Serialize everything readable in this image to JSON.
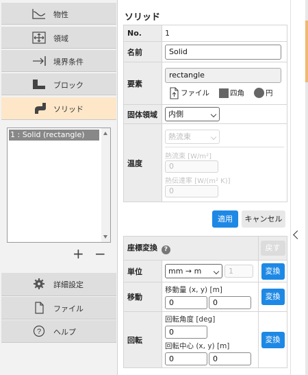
{
  "sidebar": {
    "items": [
      {
        "label": "物性",
        "icon": "curve-icon"
      },
      {
        "label": "領域",
        "icon": "move-arrows-icon"
      },
      {
        "label": "境界条件",
        "icon": "arrow-to-wall-icon"
      },
      {
        "label": "ブロック",
        "icon": "block-icon"
      },
      {
        "label": "ソリッド",
        "icon": "solid-pipe-icon"
      }
    ],
    "solid_list": [
      "1 : Solid (rectangle)"
    ],
    "add_label": "+",
    "remove_label": "−",
    "bottom_items": [
      {
        "label": "詳細設定",
        "icon": "gear-icon"
      },
      {
        "label": "ファイル",
        "icon": "file-icon"
      },
      {
        "label": "ヘルプ",
        "icon": "help-icon"
      }
    ],
    "active_item": "ソリッド"
  },
  "panel": {
    "title": "ソリッド",
    "no_label": "No.",
    "no_value": "1",
    "name_label": "名前",
    "name_value": "Solid",
    "element_label": "要素",
    "element_value": "rectangle",
    "shape_file": "ファイル",
    "shape_rect": "四角",
    "shape_circle": "円",
    "solid_region_label": "固体領域",
    "solid_region_value": "内側",
    "temperature_label": "温度",
    "heat_mode_value": "熱流束",
    "heat_flux_label": "熱流束 [W/m²]",
    "heat_flux_value": "0",
    "htc_label": "熱伝達率 [W/(m² K)]",
    "htc_value": "0",
    "apply_label": "適用",
    "cancel_label": "キャンセル"
  },
  "transform": {
    "title": "座標変換",
    "help": "?",
    "reset_label": "戻す",
    "unit_label": "単位",
    "unit_value": "mm → m",
    "unit_factor": "1",
    "convert_label": "変換",
    "move_label": "移動",
    "move_amount_label": "移動量 (x, y) [m]",
    "move_x": "0",
    "move_y": "0",
    "rotate_label": "回転",
    "rotate_angle_label": "回転角度 [deg]",
    "rotate_angle": "0",
    "rotate_center_label": "回転中心 (x, y) [m]",
    "rotate_cx": "0",
    "rotate_cy": "0"
  },
  "colors": {
    "accent": "#1e88e5",
    "active_nav": "#fde7c8",
    "selected_list": "#888888"
  }
}
